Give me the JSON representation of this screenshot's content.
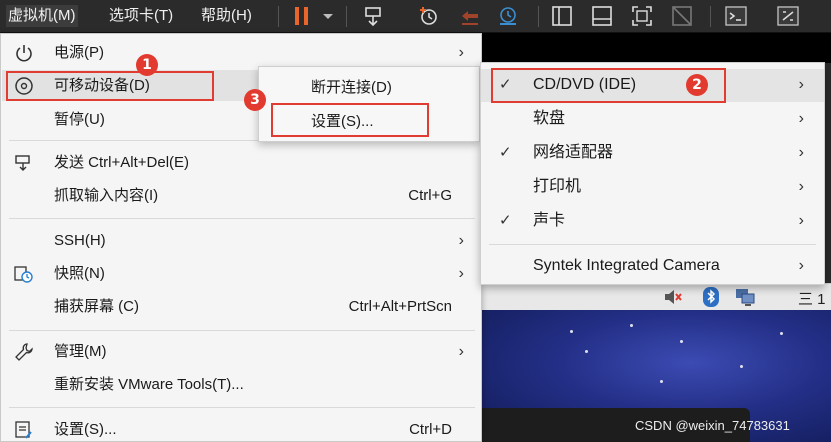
{
  "menubar": {
    "items": [
      {
        "label": "虚拟机(M)",
        "active": true
      },
      {
        "label": "选项卡(T)"
      },
      {
        "label": "帮助(H)"
      }
    ]
  },
  "toolbar_icons": [
    "pause-icon",
    "dropdown-arrow-icon",
    "send-keys-icon",
    "snapshot-icon",
    "revert-snapshot-icon",
    "manage-snapshots-icon",
    "sidebar-view-icon",
    "console-view-icon",
    "fullscreen-icon",
    "unity-icon",
    "terminal-icon",
    "stretch-icon"
  ],
  "main_menu": {
    "items": [
      {
        "label": "电源(P)",
        "icon": "power-icon",
        "submenu": true
      },
      {
        "label": "可移动设备(D)",
        "icon": "disc-icon",
        "submenu": true,
        "highlighted": true
      },
      {
        "label": "暂停(U)"
      },
      {
        "label": "发送 Ctrl+Alt+Del(E)",
        "icon": "send-keys-icon"
      },
      {
        "label": "抓取输入内容(I)",
        "shortcut": "Ctrl+G"
      },
      {
        "label": "SSH(H)",
        "submenu": true
      },
      {
        "label": "快照(N)",
        "icon": "snapshot-icon",
        "submenu": true
      },
      {
        "label": "捕获屏幕 (C)",
        "shortcut": "Ctrl+Alt+PrtScn"
      },
      {
        "label": "管理(M)",
        "icon": "wrench-icon",
        "submenu": true
      },
      {
        "label": "重新安装 VMware Tools(T)..."
      },
      {
        "label": "设置(S)...",
        "icon": "settings-icon",
        "shortcut": "Ctrl+D"
      }
    ]
  },
  "submenu_device": {
    "items": [
      {
        "label": "断开连接(D)"
      },
      {
        "label": "设置(S)..."
      }
    ]
  },
  "submenu_removable": {
    "items": [
      {
        "label": "CD/DVD (IDE)",
        "checked": true,
        "highlighted": true
      },
      {
        "label": "软盘",
        "checked": false
      },
      {
        "label": "网络适配器",
        "checked": true
      },
      {
        "label": "打印机",
        "checked": false
      },
      {
        "label": "声卡",
        "checked": true
      },
      {
        "label": "Syntek Integrated Camera",
        "checked": false
      }
    ]
  },
  "callouts": [
    "1",
    "2",
    "3"
  ],
  "guest": {
    "tray_icons": [
      "volume-muted-icon",
      "bluetooth-icon",
      "network-icon"
    ],
    "tray_text": "三 1"
  },
  "watermark": "CSDN @weixin_74783631",
  "colors": {
    "highlight_red": "#e03c31",
    "menu_bg": "#f5f5f5",
    "menubar_bg": "#2b2b2b",
    "toolbar_orange": "#e8652b",
    "toolbar_blue": "#3b8fd0"
  }
}
